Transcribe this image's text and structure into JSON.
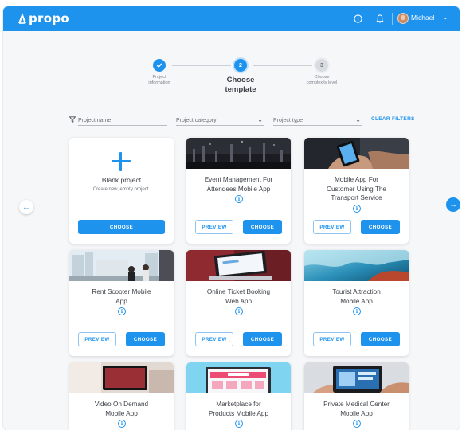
{
  "app": {
    "logo_text": "propo"
  },
  "header": {
    "user_name": "Michael"
  },
  "stepper": {
    "steps": [
      {
        "label_line1": "Project",
        "label_line2": "information",
        "number": ""
      },
      {
        "label_line1": "Choose",
        "label_line2": "template",
        "number": "2"
      },
      {
        "label_line1": "Choose",
        "label_line2": "complexity level",
        "number": "3"
      }
    ]
  },
  "filters": {
    "project_name_placeholder": "Project name",
    "project_category": "Project category",
    "project_type": "Project type",
    "clear_label": "CLEAR FILTERS"
  },
  "buttons": {
    "preview": "PREVIEW",
    "choose": "CHOOSE"
  },
  "blank_card": {
    "title": "Blank project",
    "subtitle": "Create new, empty project."
  },
  "templates": [
    {
      "title_line1": "Event Management For",
      "title_line2": "Attendees Mobile App",
      "title_line3": ""
    },
    {
      "title_line1": "Mobile App For",
      "title_line2": "Customer Using The",
      "title_line3": "Transport Service"
    },
    {
      "title_line1": "Rent Scooter Mobile",
      "title_line2": "App",
      "title_line3": ""
    },
    {
      "title_line1": "Online Ticket Booking",
      "title_line2": "Web App",
      "title_line3": ""
    },
    {
      "title_line1": "Tourist Attraction",
      "title_line2": "Mobile App",
      "title_line3": ""
    },
    {
      "title_line1": "Video On Demand",
      "title_line2": "Mobile App",
      "title_line3": ""
    },
    {
      "title_line1": "Marketplace for",
      "title_line2": "Products Mobile App",
      "title_line3": ""
    },
    {
      "title_line1": "Private Medical Center",
      "title_line2": "Mobile App",
      "title_line3": ""
    }
  ],
  "icons": {
    "logo": "logo-a-icon",
    "info": "info-icon",
    "bell": "bell-icon",
    "user_menu": "chevron-down-icon",
    "filter": "funnel-icon",
    "prev": "arrow-left-icon",
    "next": "arrow-right-icon",
    "step_done": "check-icon",
    "add": "plus-icon"
  },
  "colors": {
    "primary": "#1e93ee",
    "background": "#f6f7f9",
    "text": "#3d4047"
  }
}
